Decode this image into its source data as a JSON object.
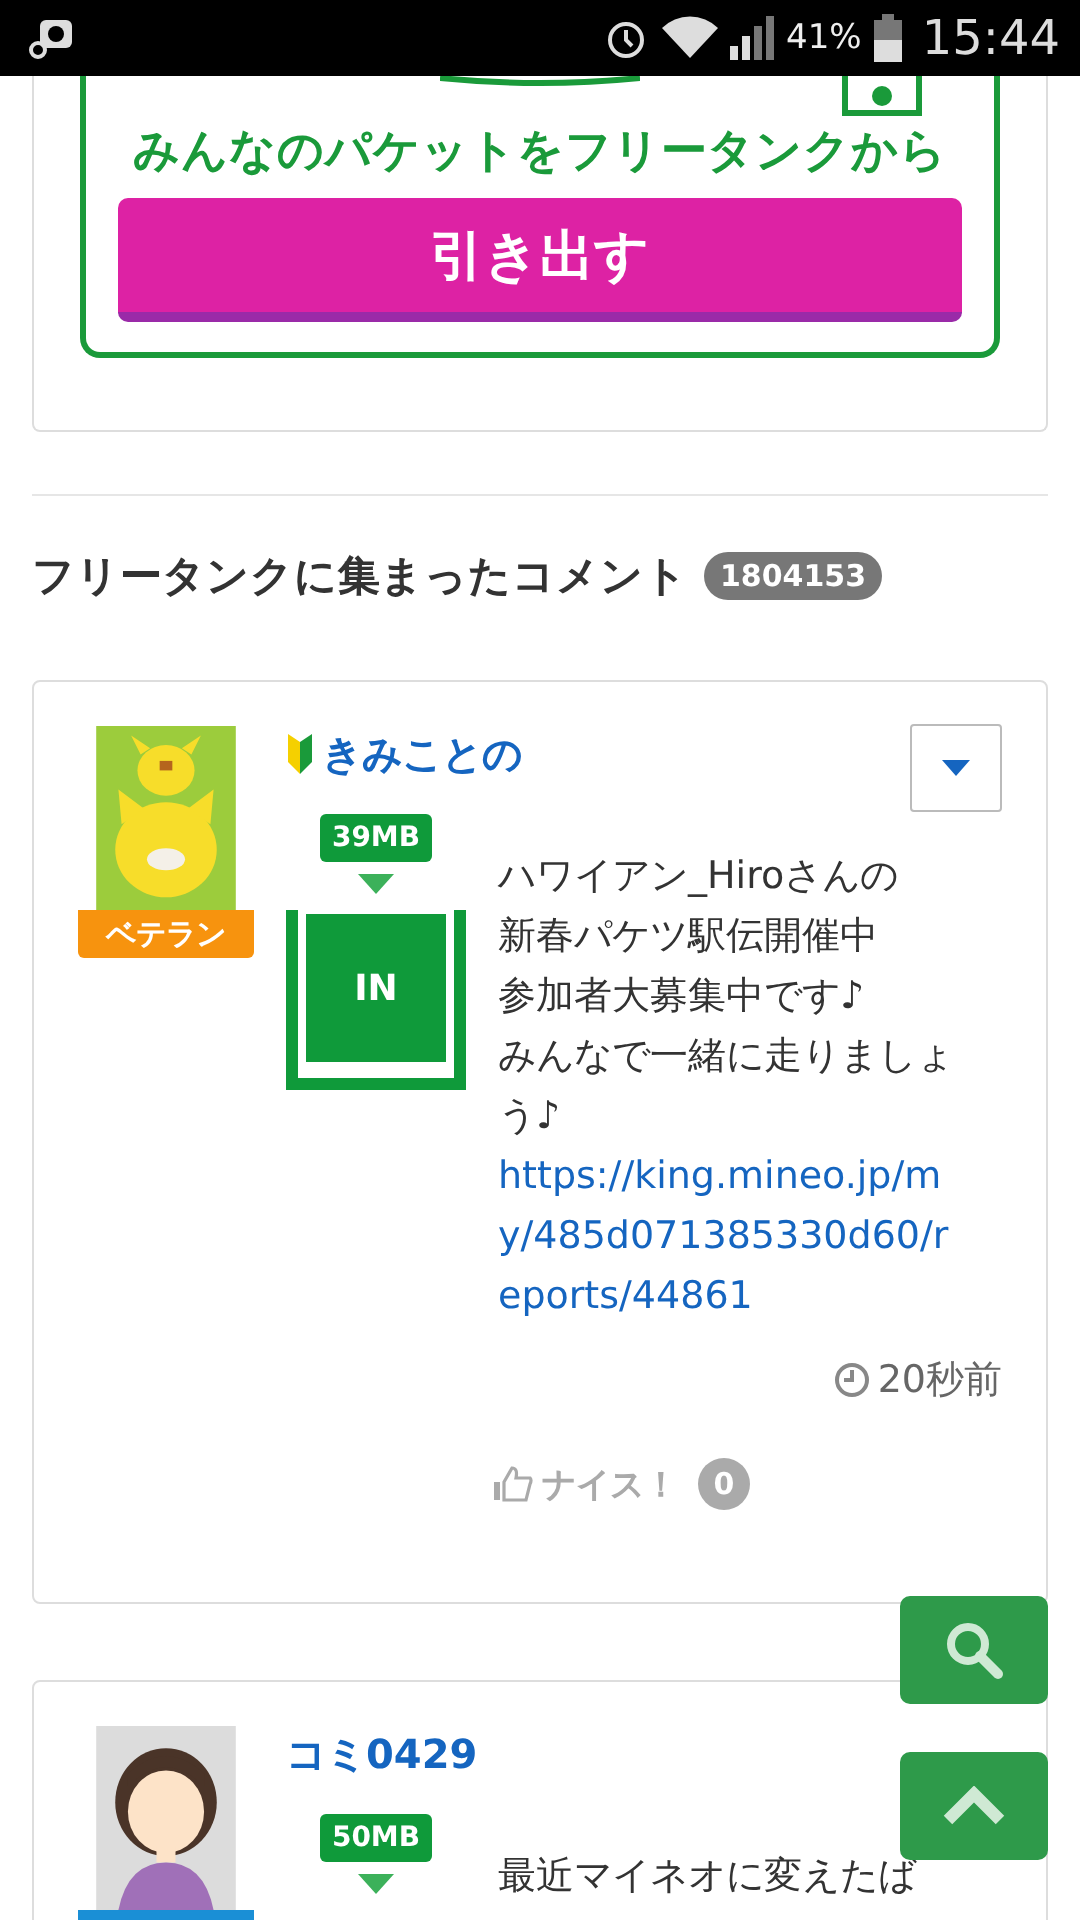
{
  "status_bar": {
    "battery": "41%",
    "time": "15:44"
  },
  "tank_panel": {
    "caption": "みんなのパケットをフリータンクから",
    "button": "引き出す"
  },
  "comments_section": {
    "title": "フリータンクに集まったコメント",
    "count": "1804153"
  },
  "comments": [
    {
      "user": "きみことの",
      "beginner": true,
      "kind": "cat",
      "rank": "ベテラン",
      "color": "#f7930e",
      "amount": "39MB",
      "direction": "IN",
      "text_lines": [
        "ハワイアン_Hiroさんの",
        "新春パケツ駅伝開催中",
        "参加者大募集中です♪",
        "みんなで一緒に走りましょう♪"
      ],
      "link": "https://king.mineo.jp/my/485d071385330d60/reports/44861",
      "time": "20秒前",
      "nice_label": "ナイス！",
      "nice_count": "0"
    },
    {
      "user": "コミ0429",
      "beginner": false,
      "kind": "person",
      "color": "#1a8fd6",
      "amount": "50MB",
      "text_lines": [
        "最近マイネオに変えたば"
      ]
    }
  ]
}
